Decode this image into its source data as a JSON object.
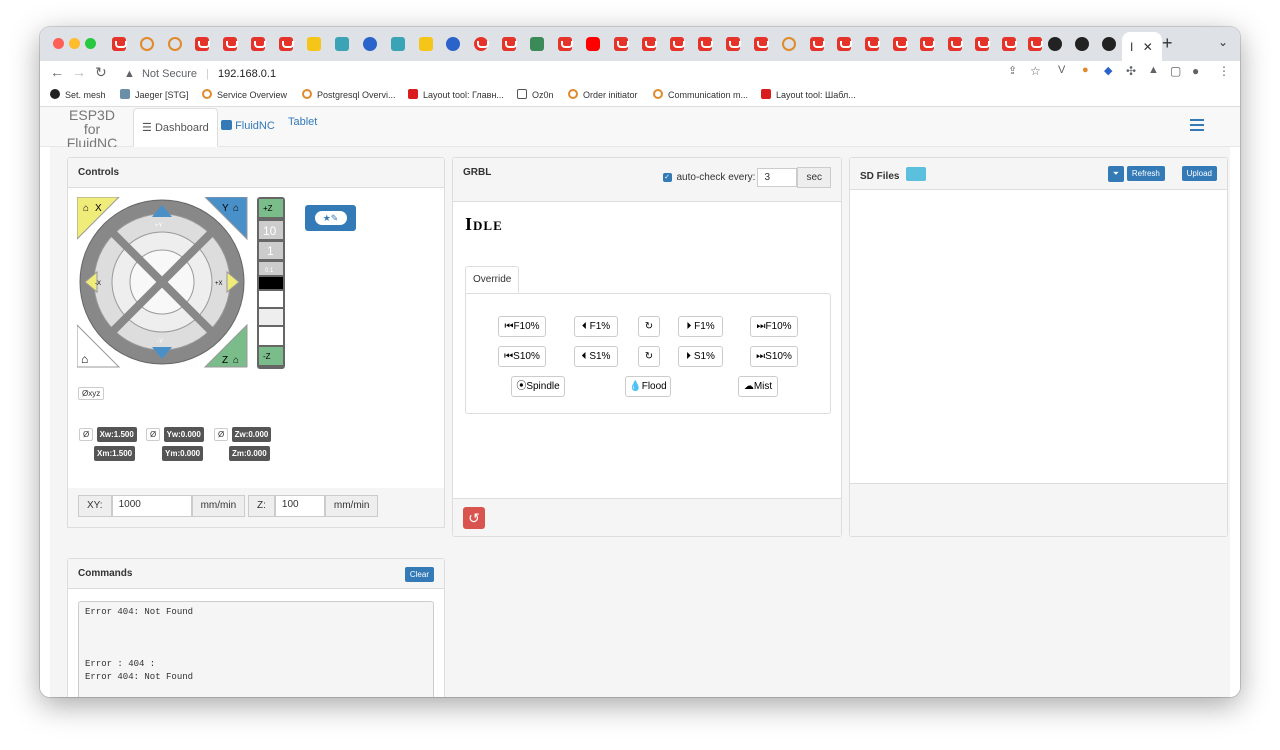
{
  "browser": {
    "active_tab_title": "I",
    "omnibox": {
      "security_label": "Not Secure",
      "url": "192.168.0.1"
    },
    "bookmarks": [
      {
        "label": "Set. mesh",
        "icon": "github-icon"
      },
      {
        "label": "Jaeger [STG]",
        "icon": "jaeger-icon"
      },
      {
        "label": "Service Overview",
        "icon": "grafana-icon"
      },
      {
        "label": "Postgresql Overvi...",
        "icon": "grafana-icon"
      },
      {
        "label": "Layout tool: Главн...",
        "icon": "red-square-icon"
      },
      {
        "label": "Oz0n",
        "icon": "folder-icon"
      },
      {
        "label": "Order initiator",
        "icon": "grafana-icon"
      },
      {
        "label": "Communication m...",
        "icon": "grafana-icon"
      },
      {
        "label": "Layout tool: Шабл...",
        "icon": "red-square-icon"
      }
    ]
  },
  "app": {
    "brand_line1": "ESP3D for",
    "brand_line2": "FluidNC",
    "nav_tabs": [
      {
        "label": "Dashboard",
        "icon": "dashboard-icon"
      },
      {
        "label": "FluidNC",
        "icon": "fluidnc-icon"
      },
      {
        "label": "Tablet"
      }
    ]
  },
  "controls": {
    "title": "Controls",
    "jog_labels": {
      "home_x": "X",
      "home_y": "Y",
      "home_z": "Z",
      "plus_z": "+Z",
      "minus_z": "-Z",
      "minus_x": "-X",
      "plus_x": "+X",
      "plus_y": "+Y",
      "minus_y": "-Y"
    },
    "z_steps": [
      "10",
      "1",
      "0.1"
    ],
    "zero_button": "Øxyz",
    "positions": {
      "xw": "Xw:1.500",
      "yw": "Yw:0.000",
      "zw": "Zw:0.000",
      "xm": "Xm:1.500",
      "ym": "Ym:0.000",
      "zm": "Zm:0.000",
      "zero_symbol": "Ø"
    },
    "feed_xy_label": "XY:",
    "feed_xy_value": "1000",
    "feed_xy_unit": "mm/min",
    "feed_z_label": "Z:",
    "feed_z_value": "100",
    "feed_z_unit": "mm/min"
  },
  "grbl": {
    "title": "GRBL",
    "autocheck_label": "auto-check every:",
    "autocheck_value": "3",
    "autocheck_unit": "sec",
    "state": "Idle",
    "override_tab": "Override",
    "override_buttons": {
      "f_minus10": "F10%",
      "f_minus1": "F1%",
      "f_plus1": "F1%",
      "f_plus10": "F10%",
      "s_minus10": "S10%",
      "s_minus1": "S1%",
      "s_plus1": "S1%",
      "s_plus10": "S10%",
      "spindle": "Spindle",
      "flood": "Flood",
      "mist": "Mist"
    }
  },
  "sd": {
    "title": "SD Files",
    "refresh": "Refresh",
    "upload": "Upload"
  },
  "commands": {
    "title": "Commands",
    "clear": "Clear",
    "log": "Error 404: Not Found\n\n\n\nError : 404 :\nError 404: Not Found"
  },
  "colors": {
    "primary": "#337ab7",
    "danger": "#d9534f",
    "jog_yellow": "#f0ec7a",
    "jog_blue": "#4a90c8",
    "jog_green": "#7bbd8a"
  }
}
